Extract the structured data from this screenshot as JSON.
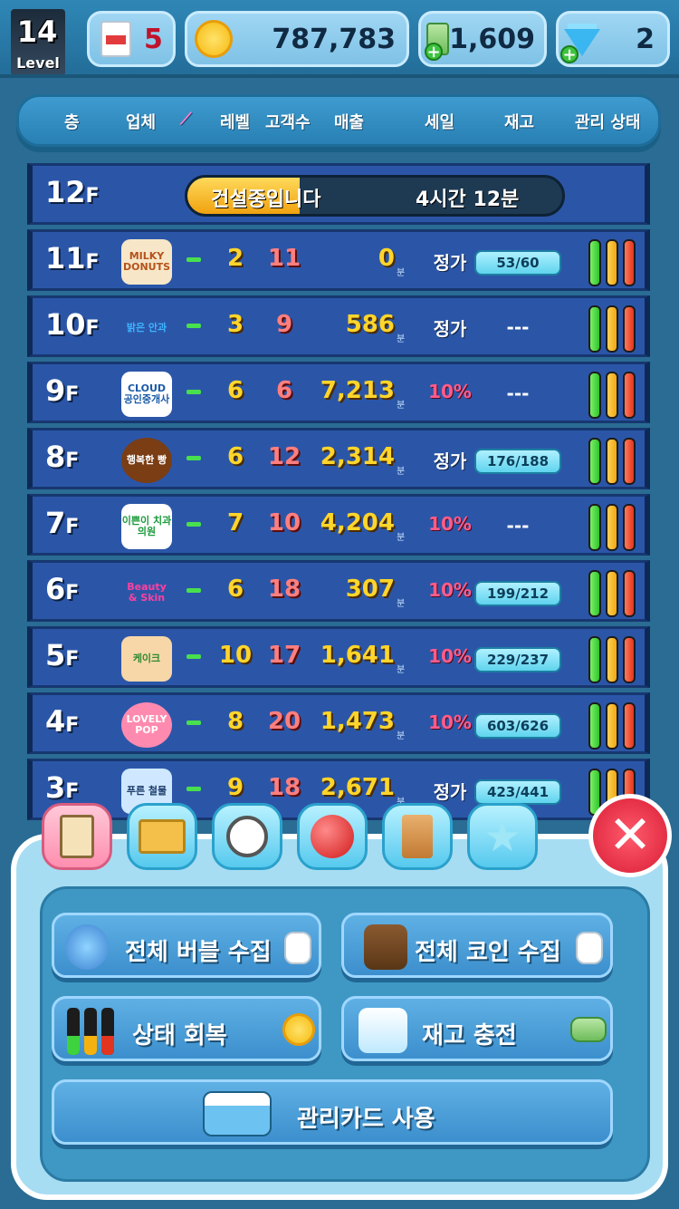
{
  "topbar": {
    "level": "14",
    "level_label": "Level",
    "milk": "5",
    "coins": "787,783",
    "cash": "1,609",
    "gems": "2"
  },
  "header": {
    "floor": "층",
    "business": "업체",
    "level": "레벨",
    "customers": "고객수",
    "sales": "매출",
    "sale": "세일",
    "stock": "재고",
    "status": "관리 상태"
  },
  "building_floor": {
    "floor": "12",
    "suffix": "F",
    "status": "건설중입니다",
    "time": "4시간 12분",
    "progress": 0.3
  },
  "floors": [
    {
      "floor": "11",
      "suffix": "F",
      "logo": "MILKY DONUTS",
      "level": "2",
      "customers": "11",
      "sales": "0",
      "per": "분",
      "sale": "정가",
      "stock": "53/60"
    },
    {
      "floor": "10",
      "suffix": "F",
      "logo": "밝은 안과",
      "level": "3",
      "customers": "9",
      "sales": "586",
      "per": "분",
      "sale": "정가",
      "stock": "---"
    },
    {
      "floor": "9",
      "suffix": "F",
      "logo": "CLOUD 공인중개사",
      "level": "6",
      "customers": "6",
      "sales": "7,213",
      "per": "분",
      "sale": "10%",
      "stock": "---"
    },
    {
      "floor": "8",
      "suffix": "F",
      "logo": "행복한 빵",
      "level": "6",
      "customers": "12",
      "sales": "2,314",
      "per": "분",
      "sale": "정가",
      "stock": "176/188"
    },
    {
      "floor": "7",
      "suffix": "F",
      "logo": "이쁜이 치과의원",
      "level": "7",
      "customers": "10",
      "sales": "4,204",
      "per": "분",
      "sale": "10%",
      "stock": "---"
    },
    {
      "floor": "6",
      "suffix": "F",
      "logo": "Beauty & Skin",
      "level": "6",
      "customers": "18",
      "sales": "307",
      "per": "분",
      "sale": "10%",
      "stock": "199/212"
    },
    {
      "floor": "5",
      "suffix": "F",
      "logo": "케이크",
      "level": "10",
      "customers": "17",
      "sales": "1,641",
      "per": "분",
      "sale": "10%",
      "stock": "229/237"
    },
    {
      "floor": "4",
      "suffix": "F",
      "logo": "LOVELY POP",
      "level": "8",
      "customers": "20",
      "sales": "1,473",
      "per": "분",
      "sale": "10%",
      "stock": "603/626"
    },
    {
      "floor": "3",
      "suffix": "F",
      "logo": "푸른 철물",
      "level": "9",
      "customers": "18",
      "sales": "2,671",
      "per": "분",
      "sale": "정가",
      "stock": "423/441"
    }
  ],
  "tabs": [
    {
      "icon": "clipboard-icon"
    },
    {
      "icon": "star-folder-icon"
    },
    {
      "icon": "stopwatch-icon"
    },
    {
      "icon": "red-ball-icon"
    },
    {
      "icon": "chair-icon"
    },
    {
      "icon": "star-icon"
    }
  ],
  "actions": {
    "collect_bubbles": "전체 버블 수집",
    "collect_coins": "전체 코인 수집",
    "restore_status": "상태 회복",
    "restock": "재고 충전",
    "use_card": "관리카드 사용"
  },
  "colors": {
    "accent": "#2b56a8",
    "sale_color": "#ff5c8a",
    "value_color": "#ffd52b",
    "close": "#d91d35"
  }
}
